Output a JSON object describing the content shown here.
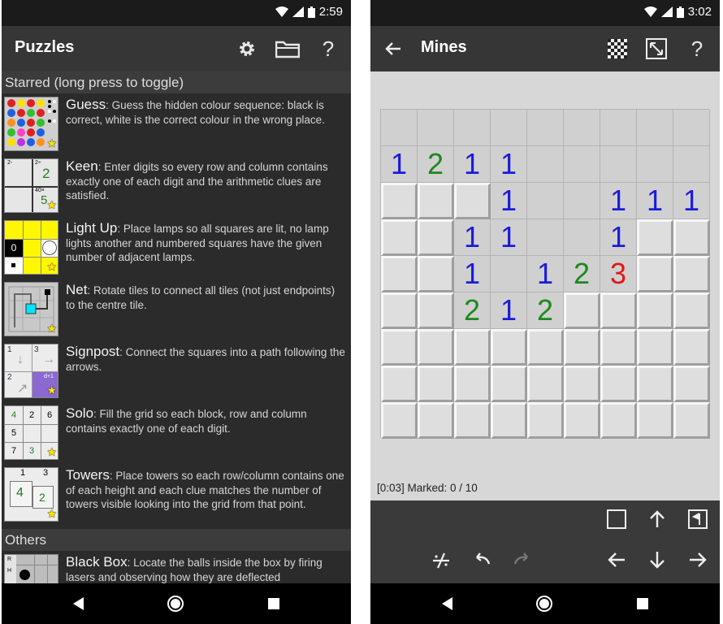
{
  "status_left": {
    "time": "2:59"
  },
  "status_right": {
    "time": "3:02"
  },
  "left_app": {
    "title": "Puzzles",
    "icons": [
      "settings-gear-icon",
      "folder-icon",
      "help-icon"
    ],
    "help_glyph": "?",
    "starred_header": "Starred (long press to toggle)",
    "others_header": "Others",
    "items": [
      {
        "name": "Guess",
        "desc": ": Guess the hidden colour sequence: black is correct, white is the correct colour in the wrong place."
      },
      {
        "name": "Keen",
        "desc": ": Enter digits so every row and column contains exactly one of each digit and the arithmetic clues are satisfied."
      },
      {
        "name": "Light Up",
        "desc": ": Place lamps so all squares are lit, no lamp lights another and numbered squares have the given number of adjacent lamps."
      },
      {
        "name": "Net",
        "desc": ": Rotate tiles to connect all tiles (not just endpoints) to the centre tile."
      },
      {
        "name": "Signpost",
        "desc": ": Connect the squares into a path following the arrows."
      },
      {
        "name": "Solo",
        "desc": ": Fill the grid so each block, row and column contains exactly one of each digit."
      },
      {
        "name": "Towers",
        "desc": ": Place towers so each row/column contains one of each height and each clue matches the number of towers visible looking into the grid from that point."
      }
    ],
    "others": [
      {
        "name": "Black Box",
        "desc": ": Locate the balls inside the box by firing lasers and observing how they are deflected"
      }
    ],
    "thumb_text": {
      "keen": {
        "clue1": "2-",
        "clue2": "2÷",
        "val": "2",
        "clue3": "40×",
        "val2": "5"
      },
      "lightup": {
        "zero": "0"
      },
      "signpost": {
        "n1": "1",
        "n3": "3",
        "n2": "2",
        "n4": "4",
        "hint": "d+1"
      },
      "solo": {
        "r1": [
          "4",
          "2",
          "6"
        ],
        "r2": [
          "5",
          "",
          ""
        ],
        "r3": [
          "7",
          "3",
          ""
        ]
      },
      "towers": {
        "t1": "1",
        "t3": "3",
        "v4": "4",
        "v2": "2"
      },
      "blackbox": {
        "r": "R",
        "h": "H"
      }
    }
  },
  "right_app": {
    "title": "Mines",
    "toolbar_icons": [
      "back-arrow-icon",
      "checker-icon",
      "resize-icon",
      "help-icon"
    ],
    "help_glyph": "?",
    "status": "[0:03] Marked: 0 / 10",
    "colors": {
      "1": "#1b1bdc",
      "2": "#1c8a1c",
      "3": "#e01818"
    },
    "grid": [
      [
        ".",
        ".",
        ".",
        ".",
        ".",
        ".",
        ".",
        ".",
        "."
      ],
      [
        "1",
        "2",
        "1",
        "1",
        ".",
        ".",
        ".",
        ".",
        "."
      ],
      [
        "#",
        "#",
        "#",
        "1",
        ".",
        ".",
        "1",
        "1",
        "1"
      ],
      [
        "#",
        "#",
        "1",
        "1",
        ".",
        ".",
        "1",
        "#",
        "#"
      ],
      [
        "#",
        "#",
        "1",
        ".",
        "1",
        "2",
        "3",
        "#",
        "#"
      ],
      [
        "#",
        "#",
        "2",
        "1",
        "2",
        "#",
        "#",
        "#",
        "#"
      ],
      [
        "#",
        "#",
        "#",
        "#",
        "#",
        "#",
        "#",
        "#",
        "#"
      ],
      [
        "#",
        "#",
        "#",
        "#",
        "#",
        "#",
        "#",
        "#",
        "#"
      ],
      [
        "#",
        "#",
        "#",
        "#",
        "#",
        "#",
        "#",
        "#",
        "#"
      ]
    ],
    "controls": [
      "square-icon",
      "arrow-up-icon",
      "flag-icon",
      "solve-icon",
      "undo-icon",
      "redo-icon",
      "arrow-left-icon",
      "arrow-down-icon",
      "arrow-right-icon"
    ]
  }
}
